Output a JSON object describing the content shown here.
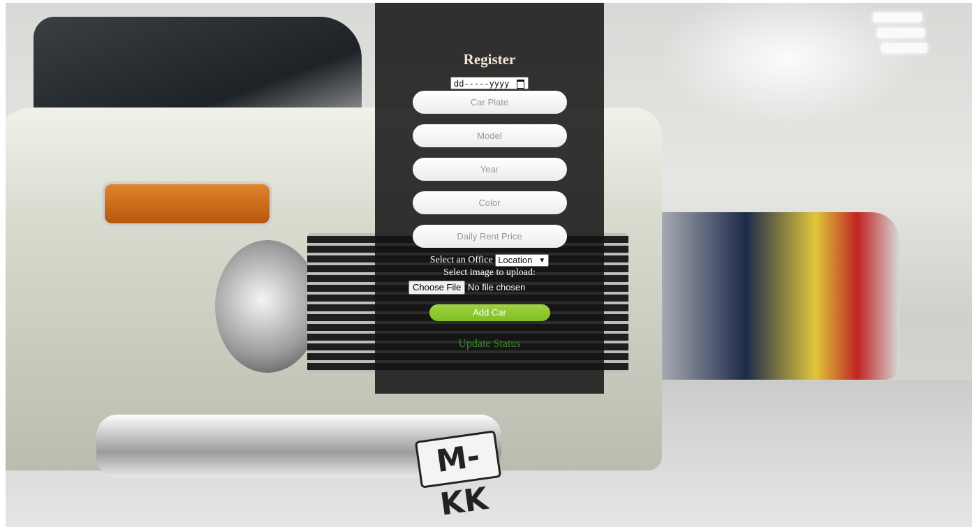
{
  "form": {
    "title": "Register",
    "date_placeholder": "dd-----yyyy",
    "car_plate_placeholder": "Car Plate",
    "model_placeholder": "Model",
    "year_placeholder": "Year",
    "color_placeholder": "Color",
    "daily_price_placeholder": "Daily Rent Price",
    "office_label": "Select an Office",
    "office_selected": "Location",
    "upload_label": "Select image to upload:",
    "choose_file_label": "Choose File",
    "no_file_text": "No file chosen",
    "add_button": "Add Car",
    "status_text": "Update Status"
  },
  "background": {
    "plate_text": "M-KK"
  },
  "colors": {
    "panel": "#141414",
    "title": "#f1e8d6",
    "add_button": "#8cc63f",
    "status": "#3b8a2a"
  }
}
